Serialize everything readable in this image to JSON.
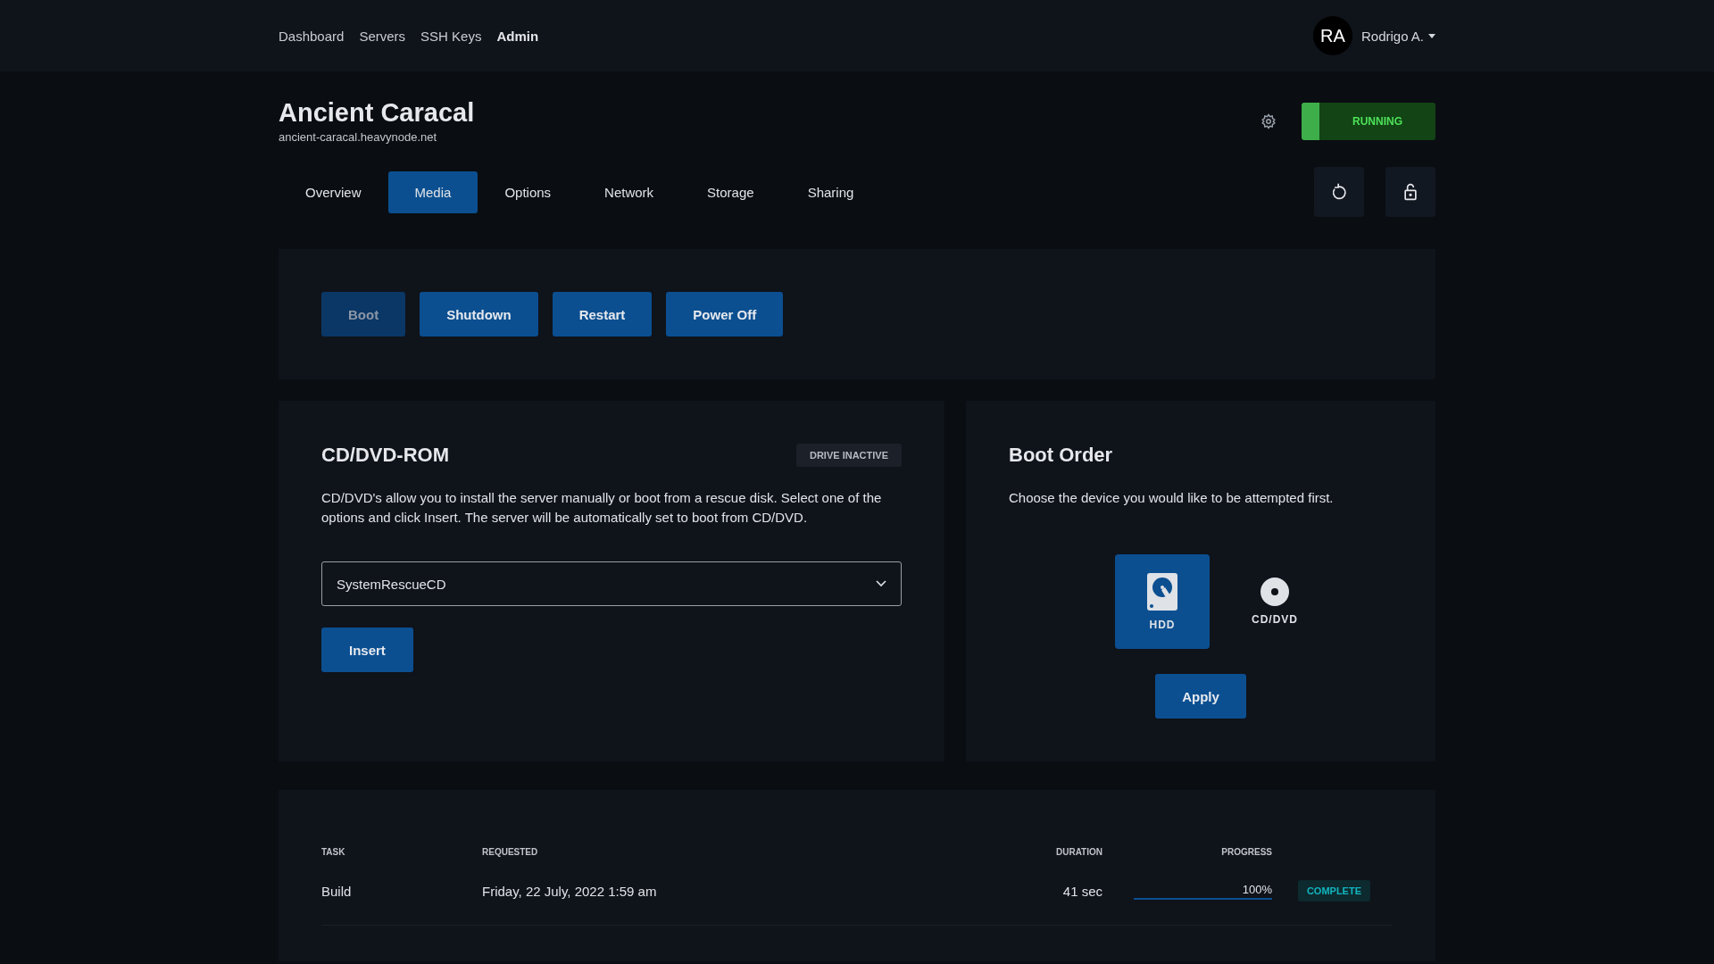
{
  "nav": {
    "links": [
      {
        "label": "Dashboard",
        "selected": false
      },
      {
        "label": "Servers",
        "selected": false
      },
      {
        "label": "SSH Keys",
        "selected": false
      },
      {
        "label": "Admin",
        "selected": true
      }
    ],
    "user": {
      "initials": "RA",
      "name": "Rodrigo A."
    }
  },
  "server": {
    "name": "Ancient Caracal",
    "hostname": "ancient-caracal.heavynode.net",
    "status": "RUNNING"
  },
  "tabs": [
    {
      "label": "Overview",
      "selected": false
    },
    {
      "label": "Media",
      "selected": true
    },
    {
      "label": "Options",
      "selected": false
    },
    {
      "label": "Network",
      "selected": false
    },
    {
      "label": "Storage",
      "selected": false
    },
    {
      "label": "Sharing",
      "selected": false
    }
  ],
  "power_buttons": [
    {
      "label": "Boot",
      "disabled": true
    },
    {
      "label": "Shutdown",
      "disabled": false
    },
    {
      "label": "Restart",
      "disabled": false
    },
    {
      "label": "Power Off",
      "disabled": false
    }
  ],
  "cd_rom": {
    "title": "CD/DVD-ROM",
    "badge": "DRIVE INACTIVE",
    "description": "CD/DVD's allow you to install the server manually or boot from a rescue disk. Select one of the options and click Insert. The server will be automatically set to boot from CD/DVD.",
    "select": "SystemRescueCD",
    "button": "Insert"
  },
  "boot_order": {
    "title": "Boot Order",
    "description": "Choose the device you would like to be attempted first.",
    "devices": [
      {
        "kind": "hdd",
        "label": "HDD",
        "selected": true
      },
      {
        "kind": "cd",
        "label": "CD/DVD",
        "selected": false
      }
    ],
    "button": "Apply"
  },
  "tasks": {
    "columns": [
      "TASK",
      "REQUESTED",
      "DURATION",
      "PROGRESS"
    ],
    "rows": [
      {
        "task": "Build",
        "requested": "Friday, 22 July, 2022 1:59 am",
        "duration": "41 sec",
        "progress": "100%",
        "level": 1,
        "status": "COMPLETE"
      }
    ]
  }
}
